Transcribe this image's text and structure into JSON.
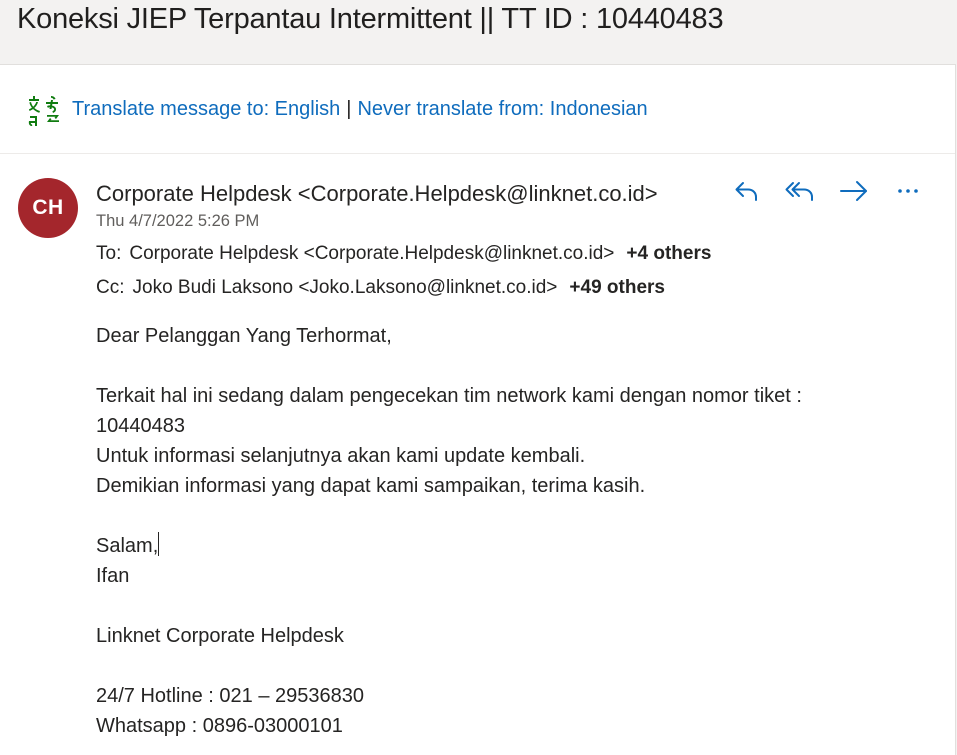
{
  "email": {
    "subject": "Koneksi JIEP Terpantau Intermittent || TT ID : 10440483",
    "translate": {
      "icon": "translate-icon",
      "translate_link": "Translate message to: English",
      "separator": "|",
      "never_link": "Never translate from: Indonesian"
    },
    "sender": {
      "initials": "CH",
      "avatar_color": "#a4262c",
      "display": "Corporate Helpdesk <Corporate.Helpdesk@linknet.co.id>",
      "date": "Thu 4/7/2022 5:26 PM"
    },
    "actions": [
      {
        "name": "reply",
        "icon": "reply-icon"
      },
      {
        "name": "reply-all",
        "icon": "reply-all-icon"
      },
      {
        "name": "forward",
        "icon": "forward-icon"
      },
      {
        "name": "more",
        "icon": "more-icon"
      }
    ],
    "to": {
      "label": "To:",
      "value": "Corporate Helpdesk <Corporate.Helpdesk@linknet.co.id>",
      "others": "+4 others"
    },
    "cc": {
      "label": "Cc:",
      "value": "Joko Budi Laksono <Joko.Laksono@linknet.co.id>",
      "others": "+49 others"
    },
    "body": {
      "greeting": "Dear Pelanggan Yang Terhormat,",
      "line1": "Terkait hal ini sedang dalam pengecekan tim network kami dengan nomor tiket :",
      "line2": "10440483",
      "line3": "Untuk informasi selanjutnya akan kami update kembali.",
      "line4": "Demikian informasi yang dapat kami sampaikan, terima kasih.",
      "closing": "Salam,",
      "signer": "Ifan",
      "team": "Linknet Corporate Helpdesk",
      "hotline": "24/7 Hotline : 021 – 29536830",
      "whatsapp": "Whatsapp : 0896-03000101"
    },
    "accent_color": "#0f6cbd"
  }
}
